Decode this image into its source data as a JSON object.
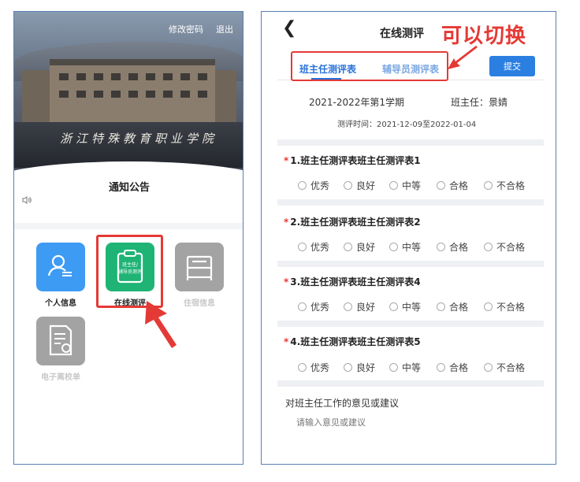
{
  "left": {
    "top_links": {
      "change_password": "修改密码",
      "logout": "退出"
    },
    "school_gate_text": "浙江特殊教育职业学院",
    "notice_title": "通知公告",
    "speaker_icon": "speaker-icon",
    "apps": [
      {
        "label": "个人信息",
        "icon": "user-info-icon",
        "color": "#3d9bf3"
      },
      {
        "label": "在线测评",
        "icon": "clipboard-icon",
        "icon_text_1": "班主任/",
        "icon_text_2": "辅导员测评",
        "color": "#1fb476"
      },
      {
        "label": "住宿信息",
        "icon": "bed-icon",
        "color": "#a3a3a3"
      },
      {
        "label": "电子离校单",
        "icon": "document-icon",
        "color": "#a3a3a3"
      }
    ]
  },
  "right": {
    "header": {
      "back_icon": "back-icon",
      "title": "在线测评"
    },
    "annotation": "可以切换",
    "tabs": [
      {
        "label": "班主任测评表",
        "active": true
      },
      {
        "label": "辅导员测评表",
        "active": false
      }
    ],
    "submit_label": "提交",
    "term": "2021-2022年第1学期",
    "teacher": "班主任：景婧",
    "eval_time": "测评时间：2021-12-09至2022-01-04",
    "questions": [
      {
        "title": "1.班主任测评表班主任测评表1"
      },
      {
        "title": "2.班主任测评表班主任测评表2"
      },
      {
        "title": "3.班主任测评表班主任测评表4"
      },
      {
        "title": "4.班主任测评表班主任测评表5"
      }
    ],
    "options": [
      "优秀",
      "良好",
      "中等",
      "合格",
      "不合格"
    ],
    "advice_label": "对班主任工作的意见或建议",
    "advice_placeholder": "请输入意见或建议"
  },
  "colors": {
    "accent_red": "#e43a35",
    "primary_blue": "#2b7fe0",
    "green": "#1fb476"
  }
}
